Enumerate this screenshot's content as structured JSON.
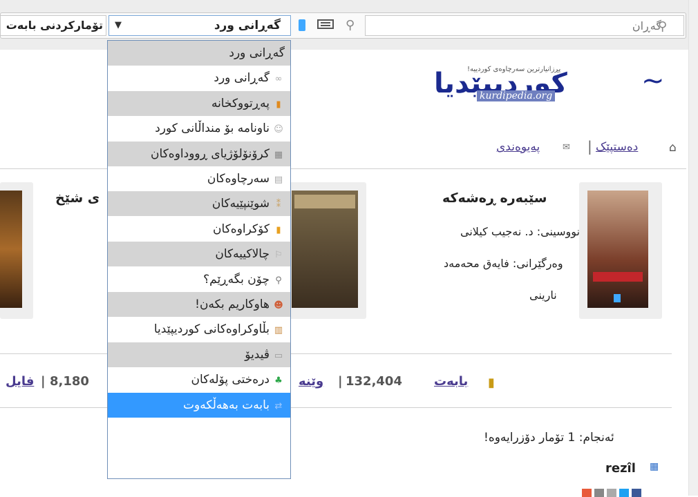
{
  "search": {
    "placeholder": "گەڕان"
  },
  "toolbar": {
    "scope_selected": "گەڕانی ورد",
    "records_selected": "تۆمارکردنی بابەت",
    "icons": [
      "search-icon",
      "list-icon",
      "mobile-icon"
    ]
  },
  "logo": {
    "tagline": "پڕزانیارترین سەرچاوەی کوردییە!",
    "name": "کوردیپێدیا",
    "url": "kurdipedia.org"
  },
  "nav": {
    "home": "دەستپێک",
    "contact": "پەیوەندی",
    "separator": "|"
  },
  "book": {
    "title": "سێبەرە ڕەشەکە",
    "author": "نووسینی: د. نەجیب کیلانی",
    "translator": "وەرگێرانی: فایەق محەمەد",
    "extra": "نارینی"
  },
  "book2": {
    "title_fragment": "ی شێخ"
  },
  "stats": {
    "label_topic": "بابەت",
    "count_topic": "132,404",
    "label_image": "وێنە",
    "count_image": "8,180",
    "label_file": "فایل",
    "separator": "|"
  },
  "result": {
    "text": "ئەنجام: 1 تۆمار دۆزرایەوە!"
  },
  "user": {
    "name": "rezîl"
  },
  "dropdown": {
    "items": [
      {
        "label": "گەڕانی ورد",
        "icon": "",
        "style": "grey"
      },
      {
        "label": "گەڕانی ورد",
        "icon": "glasses-icon",
        "style": "white"
      },
      {
        "label": "پەڕتووکخانە",
        "icon": "book-icon",
        "style": "grey"
      },
      {
        "label": "ناونامە بۆ منداڵانی کورد",
        "icon": "baby-icon",
        "style": "white"
      },
      {
        "label": "کرۆنۆلۆژیای ڕووداوەکان",
        "icon": "calendar-icon",
        "style": "grey"
      },
      {
        "label": "سەرچاوەکان",
        "icon": "document-icon",
        "style": "white"
      },
      {
        "label": "شوێنپێیەکان",
        "icon": "footprints-icon",
        "style": "grey"
      },
      {
        "label": "کۆکراوەکان",
        "icon": "collection-icon",
        "style": "white"
      },
      {
        "label": "چالاکییەکان",
        "icon": "runner-icon",
        "style": "grey"
      },
      {
        "label": "چۆن بگەڕێم؟",
        "icon": "magnifier-icon",
        "style": "white"
      },
      {
        "label": "هاوکاریم بکەن!",
        "icon": "helper-icon",
        "style": "grey"
      },
      {
        "label": "بڵاوکراوەکانی کوردیپێدیا",
        "icon": "publications-icon",
        "style": "white"
      },
      {
        "label": "ڤیدیۆ",
        "icon": "video-icon",
        "style": "grey"
      },
      {
        "label": "درەختی پۆلەکان",
        "icon": "tree-icon",
        "style": "white"
      },
      {
        "label": "بابەت بەهەڵکەوت",
        "icon": "shuffle-icon",
        "style": "selected"
      }
    ]
  },
  "colors": {
    "accent": "#3399ff",
    "link": "#4a3b8f",
    "logo": "#1b2a8f"
  }
}
